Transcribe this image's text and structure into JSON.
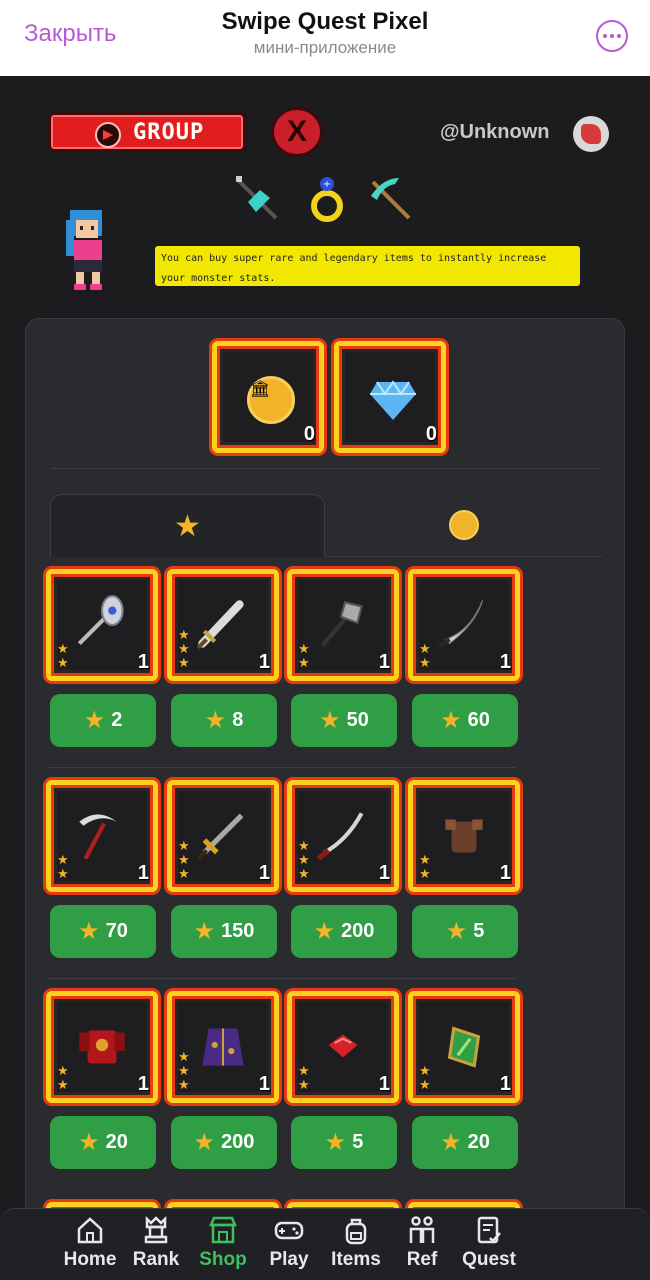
{
  "topbar": {
    "close_label": "Закрыть",
    "title": "Swipe Quest Pixel",
    "subtitle": "мини-приложение"
  },
  "header": {
    "group_label": "GROUP",
    "x_label": "X",
    "username": "@Unknown",
    "info_text": "You can buy super rare and legendary items to instantly increase your monster stats."
  },
  "balances": [
    {
      "currency": "coin",
      "amount": "0"
    },
    {
      "currency": "gem",
      "amount": "0"
    }
  ],
  "tabs": [
    {
      "name": "star",
      "active": true
    },
    {
      "name": "coin",
      "active": false
    }
  ],
  "items": [
    {
      "icon": "battle-axe-icon",
      "stars": 2,
      "qty": "1",
      "price": "2"
    },
    {
      "icon": "sword-icon",
      "stars": 3,
      "qty": "1",
      "price": "8"
    },
    {
      "icon": "axe-icon",
      "stars": 2,
      "qty": "1",
      "price": "50"
    },
    {
      "icon": "scimitar-icon",
      "stars": 2,
      "qty": "1",
      "price": "60"
    },
    {
      "icon": "scythe-icon",
      "stars": 2,
      "qty": "1",
      "price": "70"
    },
    {
      "icon": "golden-sword-icon",
      "stars": 3,
      "qty": "1",
      "price": "150"
    },
    {
      "icon": "katana-icon",
      "stars": 3,
      "qty": "1",
      "price": "200"
    },
    {
      "icon": "leather-armor-icon",
      "stars": 2,
      "qty": "1",
      "price": "5"
    },
    {
      "icon": "red-armor-icon",
      "stars": 2,
      "qty": "1",
      "price": "20"
    },
    {
      "icon": "purple-robe-icon",
      "stars": 3,
      "qty": "1",
      "price": "200"
    },
    {
      "icon": "red-gem-icon",
      "stars": 2,
      "qty": "1",
      "price": "5"
    },
    {
      "icon": "green-shield-icon",
      "stars": 2,
      "qty": "1",
      "price": "20"
    }
  ],
  "nav": [
    {
      "label": "Home",
      "icon": "home-icon",
      "active": false
    },
    {
      "label": "Rank",
      "icon": "rank-icon",
      "active": false
    },
    {
      "label": "Shop",
      "icon": "shop-icon",
      "active": true
    },
    {
      "label": "Play",
      "icon": "gamepad-icon",
      "active": false
    },
    {
      "label": "Items",
      "icon": "backpack-icon",
      "active": false
    },
    {
      "label": "Ref",
      "icon": "people-icon",
      "active": false
    },
    {
      "label": "Quest",
      "icon": "quest-icon",
      "active": false
    }
  ],
  "colors": {
    "accent_purple": "#b65bd2",
    "button_green": "#2f9e45",
    "frame_gold": "#fbd31f",
    "frame_red": "#e53a12",
    "nav_active": "#3fbf62",
    "banner_yellow": "#f2e700"
  }
}
